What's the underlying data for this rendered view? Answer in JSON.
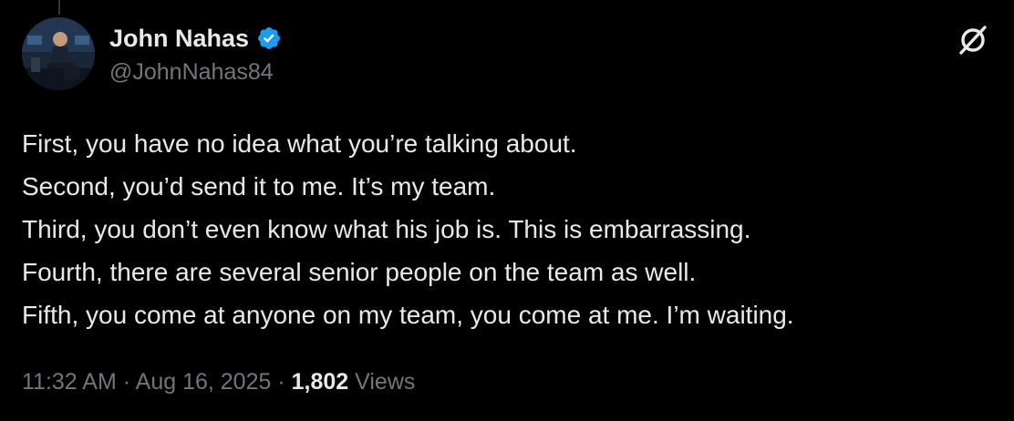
{
  "author": {
    "display_name": "John Nahas",
    "handle": "@JohnNahas84",
    "verified": true,
    "verified_color": "#1d9bf0"
  },
  "icons": {
    "avatar": "profile-photo",
    "verified": "verified-badge-icon",
    "grok": "grok-icon"
  },
  "tweet": {
    "lines": [
      "First, you have no idea what you’re talking about.",
      "Second, you’d send it to me. It’s my team.",
      "Third, you don’t even know what his job is. This is embarrassing.",
      "Fourth, there are several senior people on the team as well.",
      "Fifth, you come at anyone on my team, you come at me. I’m waiting."
    ]
  },
  "meta": {
    "time": "11:32 AM",
    "date": "Aug 16, 2025",
    "separator": "·",
    "views_count": "1,802",
    "views_label": "Views"
  },
  "colors": {
    "background": "#000000",
    "primary_text": "#e7e9ea",
    "secondary_text": "#71767b"
  }
}
